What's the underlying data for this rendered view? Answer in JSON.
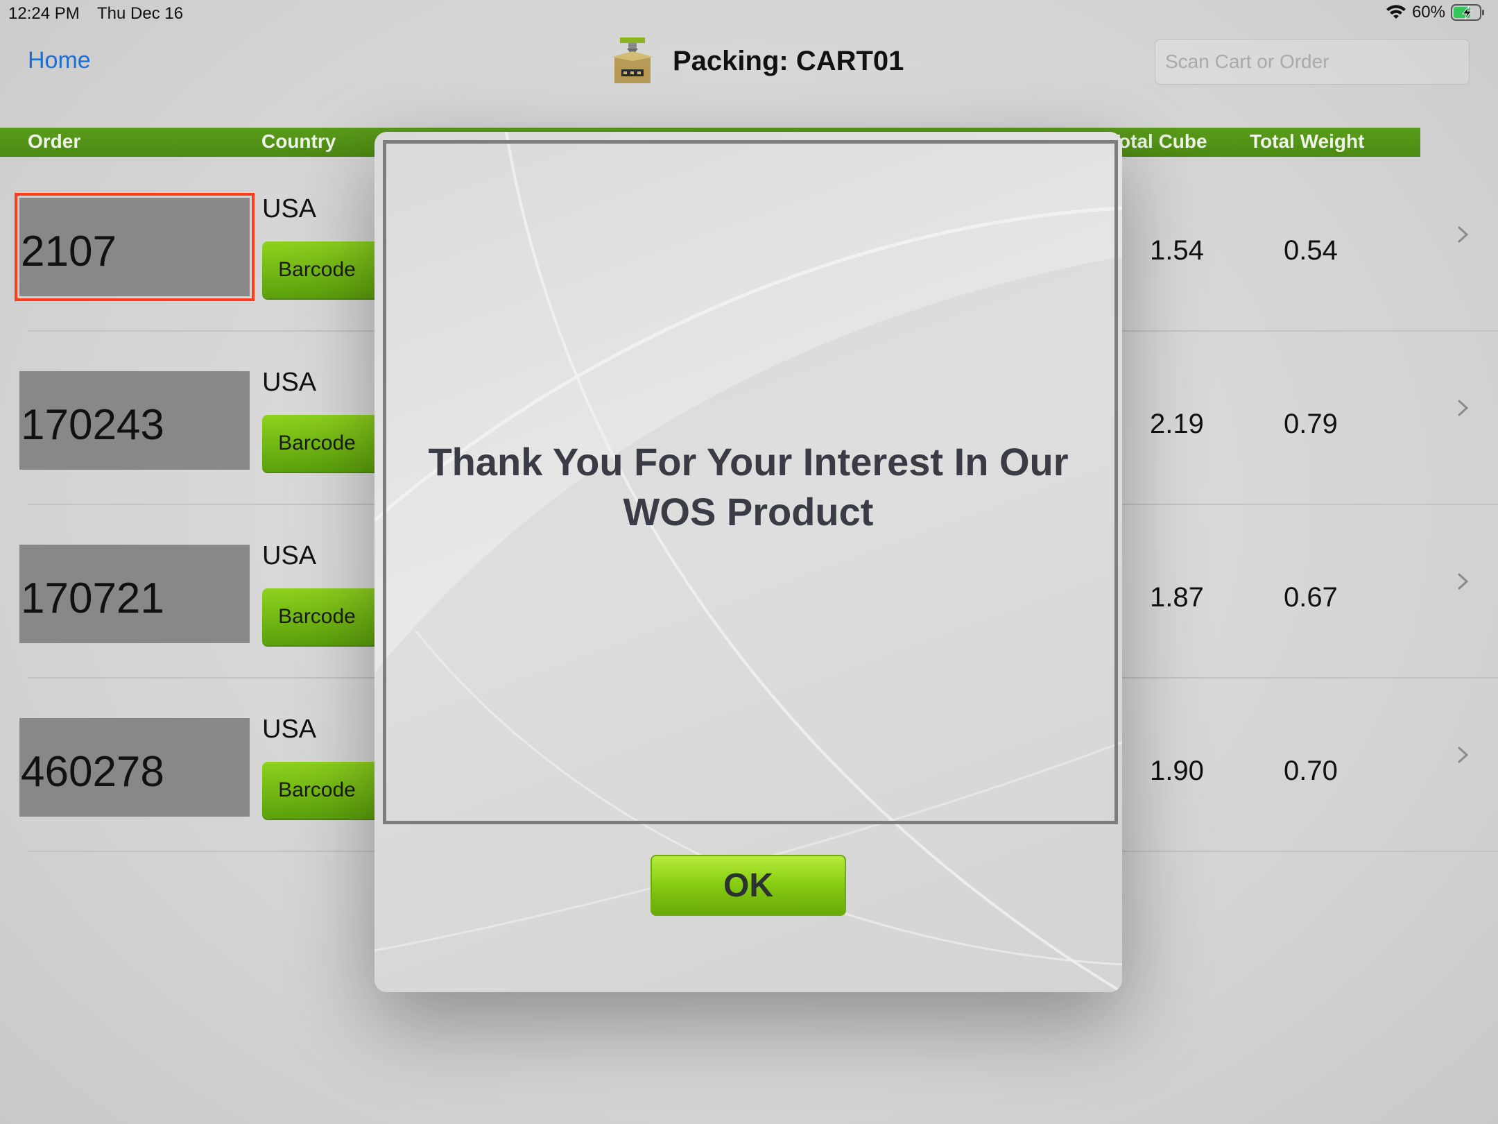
{
  "status_bar": {
    "time": "12:24 PM",
    "date": "Thu Dec 16",
    "battery": "60%"
  },
  "nav": {
    "home_label": "Home",
    "title": "Packing: CART01",
    "search_placeholder": "Scan Cart or Order"
  },
  "table": {
    "headers": {
      "order": "Order",
      "country": "Country",
      "total_cube": "Total Cube",
      "total_weight": "Total Weight"
    },
    "rows": [
      {
        "order": "2107",
        "country": "USA",
        "barcode_label": "Barcode",
        "total_cube": "1.54",
        "total_weight": "0.54"
      },
      {
        "order": "170243",
        "country": "USA",
        "barcode_label": "Barcode",
        "total_cube": "2.19",
        "total_weight": "0.79"
      },
      {
        "order": "170721",
        "country": "USA",
        "barcode_label": "Barcode",
        "total_cube": "1.87",
        "total_weight": "0.67"
      },
      {
        "order": "460278",
        "country": "USA",
        "barcode_label": "Barcode",
        "total_cube": "1.90",
        "total_weight": "0.70"
      }
    ]
  },
  "modal": {
    "message": "Thank You For Your Interest In Our WOS Product",
    "ok_label": "OK"
  },
  "colors": {
    "header_green": "#4c8a12",
    "button_green": "#7cc414",
    "selection_red": "#ff3d1a",
    "link_blue": "#1a6fd6"
  },
  "icons": [
    "wifi-icon",
    "battery-charging-icon",
    "package-logo-icon",
    "chevron-right-icon"
  ]
}
